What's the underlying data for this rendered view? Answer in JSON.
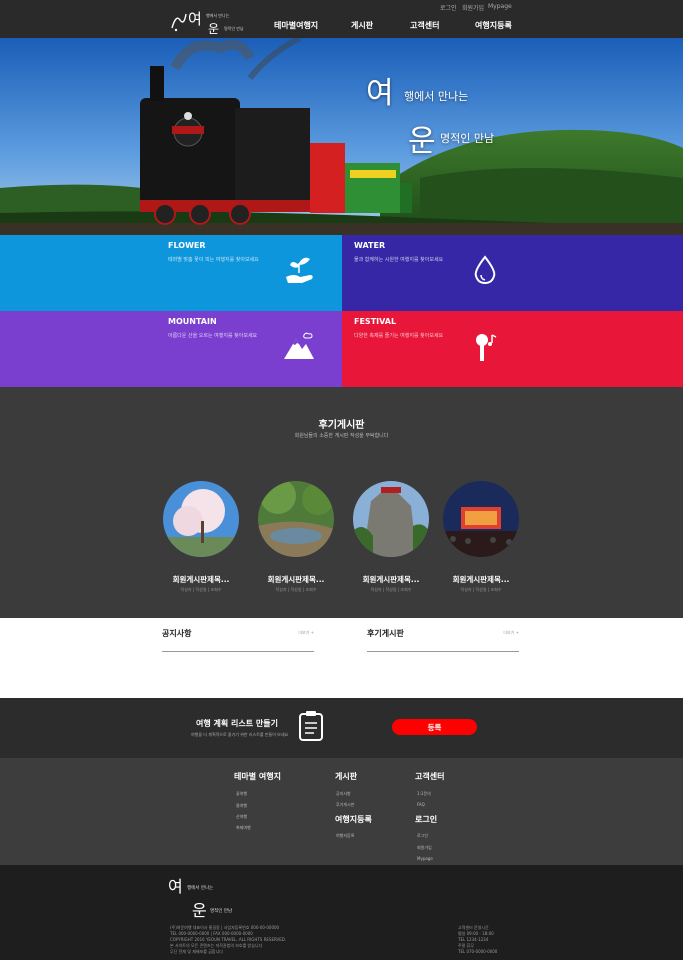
{
  "header": {
    "logo_char1": "여",
    "logo_char2": "운",
    "logo_line1": "행에서 만나는",
    "logo_line2": "명적인 만남",
    "util_links": [
      "로그인",
      "회원가입",
      "Mypage"
    ],
    "nav": [
      "테마별여행지",
      "게시판",
      "고객센터",
      "여행지등록"
    ]
  },
  "hero": {
    "char1": "여",
    "line1": "행에서 만나는",
    "char2": "운",
    "line2": "명적인 만남"
  },
  "themes": [
    {
      "title": "FLOWER",
      "desc": "테마별 맞춤 꽃이 피는 여행지를 찾아보세요",
      "color": "#0e96dc",
      "icon": "hand-plant-icon"
    },
    {
      "title": "WATER",
      "desc": "물과 함께하는 시원한 여행지를 찾아보세요",
      "color": "#3527a6",
      "icon": "water-drop-icon"
    },
    {
      "title": "MOUNTAIN",
      "desc": "아름다운 산을 오르는 여행지를 찾아보세요",
      "color": "#7b3fd0",
      "icon": "mountain-icon"
    },
    {
      "title": "FESTIVAL",
      "desc": "다양한 축제를 즐기는 여행지를 찾아보세요",
      "color": "#e8173a",
      "icon": "microphone-icon"
    }
  ],
  "reviews": {
    "title": "후기게시판",
    "subtitle": "회원님들의 소중한 게시판 작성을 부탁합니다",
    "items": [
      {
        "title": "회원게시판제목...",
        "meta": "작성자 | 작성일 | 조회수"
      },
      {
        "title": "회원게시판제목...",
        "meta": "작성자 | 작성일 | 조회수"
      },
      {
        "title": "회원게시판제목...",
        "meta": "작성자 | 작성일 | 조회수"
      },
      {
        "title": "회원게시판제목...",
        "meta": "작성자 | 작성일 | 조회수"
      }
    ]
  },
  "boards": [
    {
      "title": "공지사항",
      "more": "더보기 +"
    },
    {
      "title": "후기게시판",
      "more": "더보기 +"
    }
  ],
  "cta": {
    "title": "여행 계획 리스트 만들기",
    "subtitle": "여행을 더 계획적으로 즐기기 위한 리스트를 만들어 보세요",
    "button": "등록"
  },
  "footer_links": {
    "theme": {
      "heading": "테마별 여행지",
      "items": [
        "꽃여행",
        "물여행",
        "산여행",
        "축제여행"
      ]
    },
    "board": {
      "heading": "게시판",
      "items": [
        "공지사항",
        "후기게시판"
      ]
    },
    "register": {
      "heading": "여행지등록",
      "items": [
        "여행지등록"
      ]
    },
    "support": {
      "heading": "고객센터",
      "items": [
        "1:1문의",
        "FAQ"
      ]
    },
    "login": {
      "heading": "로그인",
      "items": [
        "로그인",
        "회원가입",
        "Mypage"
      ]
    }
  },
  "footer": {
    "char1": "여",
    "line1": "행에서 만나는",
    "char2": "운",
    "line2": "명적인 만남",
    "info_lines": [
      "(주)여운여행 대표이사 홍길동 | 사업자등록번호 000-00-00000",
      "TEL 000-0000-0000 | FAX 000-0000-0000",
      "COPYRIGHT 2016 YEOUN TRAVEL. ALL RIGHTS RESERVED.",
      "본 사이트의 모든 콘텐츠는 저작권법의 보호를 받습니다",
      "무단 전재 및 재배포를 금합니다"
    ],
    "contact_lines": [
      "고객센터 운영시간",
      "평일 09:00 - 18:00",
      "TEL 1234-1234",
      "주말 휴무",
      "TEL 070-0000-0000"
    ]
  }
}
